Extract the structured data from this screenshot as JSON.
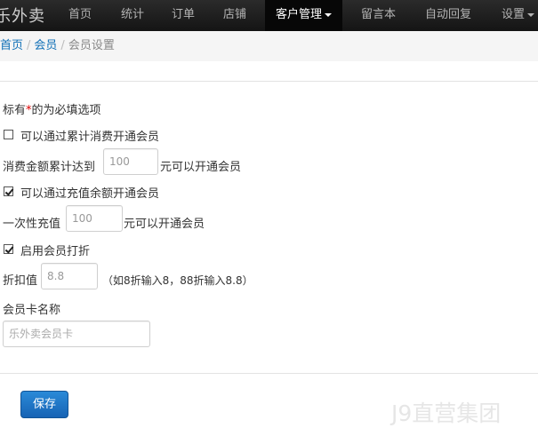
{
  "navbar": {
    "brand": "乐外卖",
    "items": [
      "首页",
      "统计",
      "订单",
      "店铺",
      "客户管理",
      "留言本",
      "自动回复",
      "设置"
    ],
    "active": "客户管理"
  },
  "breadcrumb": {
    "home": "首页",
    "section": "会员",
    "current": "会员设置"
  },
  "form": {
    "required_note_prefix": "标有",
    "required_mark": "*",
    "required_note_suffix": "的为必填选项",
    "option_spend": {
      "label": "可以通过累计消费开通会员",
      "checked": false
    },
    "spend_prefix": "消费金额累计达到",
    "spend_value": "100",
    "spend_suffix": "元可以开通会员",
    "option_recharge": {
      "label": "可以通过充值余额开通会员",
      "checked": true
    },
    "recharge_prefix": "一次性充值",
    "recharge_value": "100",
    "recharge_suffix": "元可以开通会员",
    "option_discount": {
      "label": "启用会员打折",
      "checked": true
    },
    "discount_prefix": "折扣值",
    "discount_value": "8.8",
    "discount_hint": "（如8折输入8，88折输入8.8）",
    "card_name_label": "会员卡名称",
    "card_name_placeholder": "乐外卖会员卡",
    "save_label": "保存"
  },
  "watermark": "J9直营集团"
}
